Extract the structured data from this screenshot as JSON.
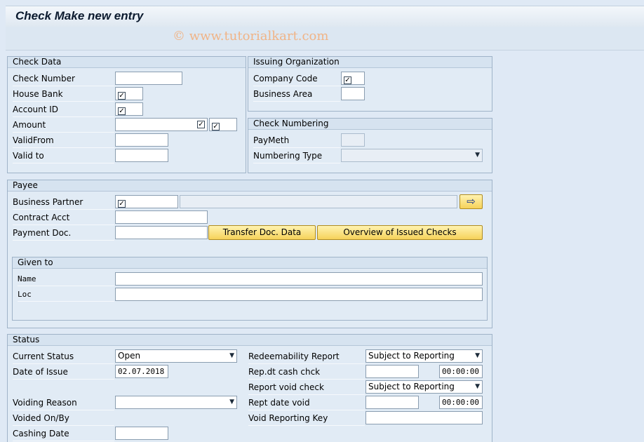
{
  "window": {
    "title": "Check Make new entry"
  },
  "watermark": "© www.tutorialkart.com",
  "check_data": {
    "title": "Check Data",
    "check_number_label": "Check Number",
    "house_bank_label": "House Bank",
    "account_id_label": "Account ID",
    "amount_label": "Amount",
    "valid_from_label": "ValidFrom",
    "valid_to_label": "Valid to",
    "checkmark": "✓"
  },
  "issuing_org": {
    "title": "Issuing Organization",
    "company_code_label": "Company Code",
    "business_area_label": "Business Area"
  },
  "check_numbering": {
    "title": "Check Numbering",
    "paymeth_label": "PayMeth",
    "numbering_type_label": "Numbering Type"
  },
  "payee": {
    "title": "Payee",
    "business_partner_label": "Business Partner",
    "contract_acct_label": "Contract Acct",
    "payment_doc_label": "Payment Doc.",
    "transfer_button": "Transfer Doc. Data",
    "overview_button": "Overview of Issued Checks",
    "arrow": "⇨"
  },
  "given_to": {
    "title": "Given to",
    "name_label": "Name",
    "loc_label": "Loc"
  },
  "status": {
    "title": "Status",
    "current_status_label": "Current Status",
    "current_status_value": "Open",
    "date_of_issue_label": "Date of Issue",
    "date_of_issue_value": "02.07.2018",
    "voiding_reason_label": "Voiding Reason",
    "voided_on_by_label": "Voided On/By",
    "cashing_date_label": "Cashing Date",
    "redeemability_label": "Redeemability Report",
    "redeemability_value": "Subject to Reporting",
    "rep_dt_cash_label": "Rep.dt cash chck",
    "rep_dt_cash_time": "00:00:00",
    "report_void_label": "Report void check",
    "report_void_value": "Subject to Reporting",
    "rept_date_void_label": "Rept date void",
    "rept_date_void_time": "00:00:00",
    "void_reporting_key_label": "Void Reporting Key"
  },
  "icons": {
    "dropdown": "▼"
  }
}
